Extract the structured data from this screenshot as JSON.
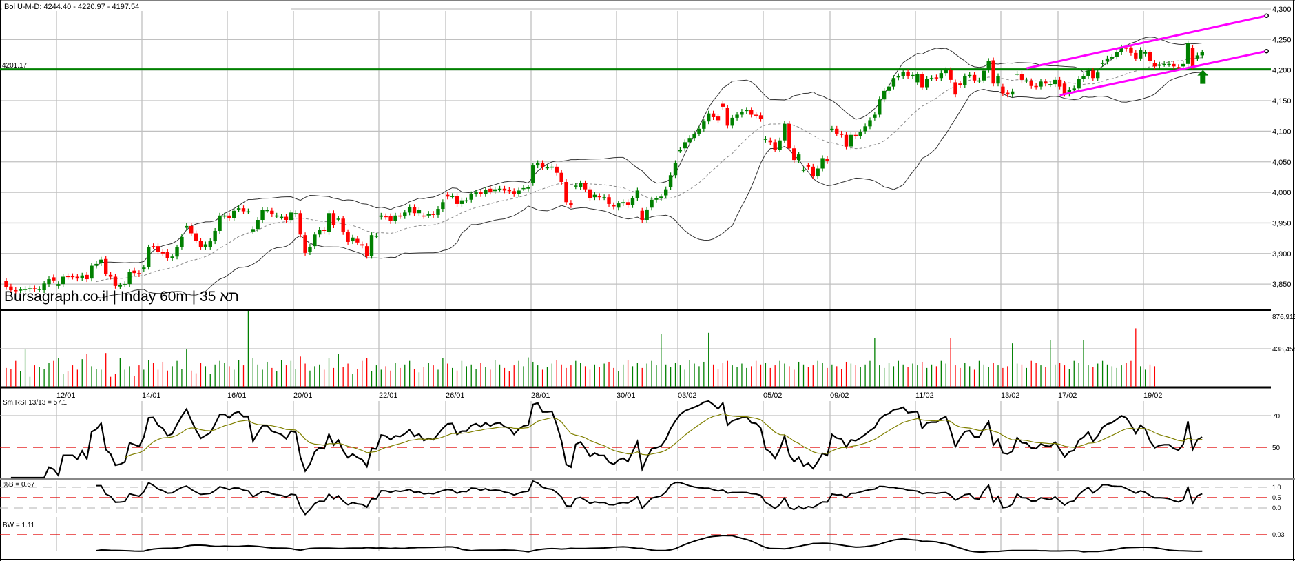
{
  "header": {
    "bollinger_label": "Bol U-M-D: 4244.40 - 4220.97 - 4197.54",
    "level_label": "4201.17",
    "watermark": "Bursagraph.co.il | Inday 60m | 35 תא"
  },
  "colors": {
    "up": "#008000",
    "down": "#ff0000",
    "trendline": "#ff00ff",
    "level": "#008000",
    "band": "#333333",
    "rsi_signal": "#808000"
  },
  "chart_data": [
    {
      "type": "candlestick",
      "title": "",
      "y_ticks": [
        "4,300",
        "4,250",
        "4,200",
        "4,150",
        "4,100",
        "4,050",
        "4,000",
        "3,950",
        "3,900",
        "3,850"
      ],
      "y_tick_values": [
        4300,
        4250,
        4200,
        4150,
        4100,
        4050,
        4000,
        3950,
        3900,
        3850
      ],
      "ylim": [
        3830,
        4315
      ],
      "x_ticks": [
        "12/01",
        "14/01",
        "16/01",
        "20/01",
        "22/01",
        "26/01",
        "28/01",
        "30/01",
        "03/02",
        "05/02",
        "09/02",
        "11/02",
        "13/02",
        "17/02",
        "19/02"
      ],
      "x_tick_bar_index": [
        11,
        29,
        47,
        61,
        79,
        93,
        111,
        129,
        142,
        160,
        174,
        192,
        210,
        222,
        240
      ],
      "horizontal_level": 4201.17,
      "trendlines": [
        {
          "from": [
            215,
            4203
          ],
          "to": [
            266,
            4289
          ]
        },
        {
          "from": [
            222,
            4159
          ],
          "to": [
            266,
            4231
          ]
        }
      ],
      "signal_arrow": {
        "bar_index": 252,
        "direction": "up"
      },
      "overlay": "Bollinger Bands (20)",
      "open_close": [
        [
          3855,
          3845
        ],
        [
          3846,
          3840
        ],
        [
          3840,
          3839
        ],
        [
          3840,
          3841
        ],
        [
          3841,
          3842
        ],
        [
          3842,
          3843
        ],
        [
          3843,
          3842
        ],
        [
          3841,
          3842
        ],
        [
          3840,
          3851
        ],
        [
          3850,
          3858
        ],
        [
          3861,
          3856
        ],
        [
          3847,
          3850
        ],
        [
          3850,
          3862
        ],
        [
          3863,
          3862
        ],
        [
          3863,
          3862
        ],
        [
          3862,
          3859
        ],
        [
          3860,
          3864
        ],
        [
          3865,
          3858
        ],
        [
          3859,
          3880
        ],
        [
          3880,
          3883
        ],
        [
          3884,
          3890
        ],
        [
          3891,
          3867
        ],
        [
          3865,
          3862
        ],
        [
          3862,
          3847
        ],
        [
          3846,
          3848
        ],
        [
          3849,
          3850
        ],
        [
          3850,
          3870
        ],
        [
          3872,
          3868
        ],
        [
          3868,
          3866
        ],
        [
          3875,
          3877
        ],
        [
          3878,
          3910
        ],
        [
          3912,
          3911
        ],
        [
          3912,
          3903
        ],
        [
          3903,
          3900
        ],
        [
          3902,
          3892
        ],
        [
          3892,
          3895
        ],
        [
          3895,
          3910
        ],
        [
          3910,
          3927
        ],
        [
          3942,
          3945
        ],
        [
          3945,
          3933
        ],
        [
          3933,
          3921
        ],
        [
          3921,
          3910
        ],
        [
          3910,
          3915
        ],
        [
          3910,
          3920
        ],
        [
          3920,
          3937
        ],
        [
          3937,
          3962
        ],
        [
          3961,
          3962
        ],
        [
          3962,
          3958
        ],
        [
          3958,
          3970
        ],
        [
          3972,
          3974
        ],
        [
          3974,
          3969
        ],
        [
          3969,
          3969
        ],
        [
          3936,
          3940
        ],
        [
          3940,
          3955
        ],
        [
          3955,
          3971
        ],
        [
          3971,
          3971
        ],
        [
          3970,
          3964
        ],
        [
          3962,
          3962
        ],
        [
          3960,
          3960
        ],
        [
          3960,
          3955
        ],
        [
          3955,
          3967
        ],
        [
          3964,
          3966
        ],
        [
          3966,
          3931
        ],
        [
          3930,
          3901
        ],
        [
          3902,
          3911
        ],
        [
          3912,
          3931
        ],
        [
          3931,
          3939
        ],
        [
          3939,
          3937
        ],
        [
          3935,
          3966
        ],
        [
          3966,
          3946
        ],
        [
          3957,
          3957
        ],
        [
          3957,
          3935
        ],
        [
          3935,
          3919
        ],
        [
          3920,
          3926
        ],
        [
          3924,
          3918
        ],
        [
          3915,
          3913
        ],
        [
          3912,
          3896
        ],
        [
          3896,
          3930
        ],
        [
          3929,
          3929
        ],
        [
          3960,
          3962
        ],
        [
          3961,
          3960
        ],
        [
          3961,
          3953
        ],
        [
          3953,
          3962
        ],
        [
          3962,
          3961
        ],
        [
          3961,
          3967
        ],
        [
          3967,
          3976
        ],
        [
          3976,
          3966
        ],
        [
          3966,
          3971
        ],
        [
          3962,
          3961
        ],
        [
          3962,
          3965
        ],
        [
          3965,
          3963
        ],
        [
          3963,
          3973
        ],
        [
          3973,
          3984
        ],
        [
          3996,
          3993
        ],
        [
          3994,
          3994
        ],
        [
          3994,
          3981
        ],
        [
          3981,
          3987
        ],
        [
          3987,
          3987
        ],
        [
          3988,
          3997
        ],
        [
          3997,
          4000
        ],
        [
          4000,
          3997
        ],
        [
          3997,
          4004
        ],
        [
          4006,
          4001
        ],
        [
          4002,
          4005
        ],
        [
          4006,
          4006
        ],
        [
          4006,
          4003
        ],
        [
          4004,
          4002
        ],
        [
          4002,
          3997
        ],
        [
          3997,
          4003
        ],
        [
          4007,
          4007
        ],
        [
          4006,
          4008
        ],
        [
          4015,
          4044
        ],
        [
          4044,
          4048
        ],
        [
          4048,
          4041
        ],
        [
          4041,
          4041
        ],
        [
          4041,
          4042
        ],
        [
          4042,
          4032
        ],
        [
          4032,
          4017
        ],
        [
          4017,
          3984
        ],
        [
          3983,
          3979
        ],
        [
          4010,
          4011
        ],
        [
          4008,
          4015
        ],
        [
          4015,
          4005
        ],
        [
          4005,
          3991
        ],
        [
          3992,
          3996
        ],
        [
          3994,
          3992
        ],
        [
          3992,
          3992
        ],
        [
          3992,
          3981
        ],
        [
          3979,
          3977
        ],
        [
          3975,
          3982
        ],
        [
          3982,
          3984
        ],
        [
          3984,
          3979
        ],
        [
          3979,
          3990
        ],
        [
          3990,
          4003
        ],
        [
          3970,
          3955
        ],
        [
          3955,
          3972
        ],
        [
          3975,
          3988
        ],
        [
          3988,
          3990
        ],
        [
          3991,
          3993
        ],
        [
          3995,
          4005
        ],
        [
          4008,
          4028
        ],
        [
          4028,
          4048
        ],
        [
          4069,
          4069
        ],
        [
          4072,
          4082
        ],
        [
          4082,
          4089
        ],
        [
          4089,
          4096
        ],
        [
          4096,
          4104
        ],
        [
          4104,
          4116
        ],
        [
          4116,
          4129
        ],
        [
          4129,
          4123
        ],
        [
          4124,
          4118
        ],
        [
          4145,
          4140
        ],
        [
          4138,
          4109
        ],
        [
          4109,
          4122
        ],
        [
          4122,
          4127
        ],
        [
          4127,
          4132
        ],
        [
          4133,
          4135
        ],
        [
          4135,
          4127
        ],
        [
          4127,
          4126
        ],
        [
          4126,
          4120
        ],
        [
          4086,
          4088
        ],
        [
          4085,
          4082
        ],
        [
          4082,
          4070
        ],
        [
          4070,
          4085
        ],
        [
          4085,
          4112
        ],
        [
          4112,
          4072
        ],
        [
          4072,
          4053
        ],
        [
          4053,
          4062
        ],
        [
          4037,
          4037
        ],
        [
          4044,
          4042
        ],
        [
          4042,
          4026
        ],
        [
          4026,
          4039
        ],
        [
          4039,
          4056
        ],
        [
          4055,
          4051
        ],
        [
          4103,
          4104
        ],
        [
          4104,
          4096
        ],
        [
          4096,
          4094
        ],
        [
          4094,
          4075
        ],
        [
          4075,
          4094
        ],
        [
          4094,
          4092
        ],
        [
          4092,
          4099
        ],
        [
          4100,
          4108
        ],
        [
          4108,
          4118
        ],
        [
          4122,
          4127
        ],
        [
          4127,
          4152
        ],
        [
          4152,
          4166
        ],
        [
          4166,
          4173
        ],
        [
          4173,
          4187
        ],
        [
          4188,
          4190
        ],
        [
          4190,
          4197
        ],
        [
          4197,
          4190
        ],
        [
          4190,
          4192
        ],
        [
          4180,
          4193
        ],
        [
          4193,
          4172
        ],
        [
          4172,
          4185
        ],
        [
          4187,
          4187
        ],
        [
          4188,
          4187
        ],
        [
          4187,
          4195
        ],
        [
          4195,
          4200
        ],
        [
          4200,
          4184
        ],
        [
          4180,
          4160
        ],
        [
          4178,
          4176
        ],
        [
          4176,
          4190
        ],
        [
          4192,
          4192
        ],
        [
          4192,
          4183
        ],
        [
          4183,
          4183
        ],
        [
          4183,
          4199
        ],
        [
          4200,
          4215
        ],
        [
          4216,
          4178
        ],
        [
          4178,
          4190
        ],
        [
          4173,
          4162
        ],
        [
          4163,
          4160
        ],
        [
          4160,
          4165
        ],
        [
          4194,
          4194
        ],
        [
          4194,
          4184
        ],
        [
          4183,
          4183
        ],
        [
          4182,
          4174
        ],
        [
          4174,
          4173
        ],
        [
          4173,
          4181
        ],
        [
          4181,
          4178
        ],
        [
          4177,
          4177
        ],
        [
          4177,
          4184
        ],
        [
          4184,
          4173
        ],
        [
          4178,
          4161
        ],
        [
          4161,
          4168
        ],
        [
          4168,
          4170
        ],
        [
          4170,
          4185
        ],
        [
          4185,
          4190
        ],
        [
          4190,
          4199
        ],
        [
          4199,
          4187
        ],
        [
          4187,
          4196
        ],
        [
          4210,
          4212
        ],
        [
          4214,
          4219
        ],
        [
          4219,
          4222
        ],
        [
          4222,
          4229
        ],
        [
          4229,
          4237
        ],
        [
          4237,
          4235
        ],
        [
          4237,
          4228
        ],
        [
          4228,
          4219
        ],
        [
          4219,
          4233
        ],
        [
          4227,
          4229
        ],
        [
          4229,
          4215
        ],
        [
          4212,
          4206
        ],
        [
          4207,
          4209
        ],
        [
          4210,
          4210
        ],
        [
          4210,
          4210
        ],
        [
          4210,
          4206
        ],
        [
          4205,
          4204
        ],
        [
          4206,
          4210
        ],
        [
          4210,
          4244
        ],
        [
          4236,
          4206
        ],
        [
          4219,
          4224
        ],
        [
          4224,
          4229
        ]
      ]
    },
    {
      "type": "bar",
      "title": "",
      "y_ticks": [
        "876,915",
        "438,458"
      ],
      "y_tick_values": [
        876915,
        438458
      ],
      "volume_thousands": [
        220,
        210,
        300,
        180,
        430,
        120,
        250,
        230,
        210,
        280,
        300,
        330,
        150,
        180,
        250,
        200,
        320,
        380,
        240,
        210,
        200,
        390,
        120,
        150,
        330,
        200,
        240,
        130,
        250,
        200,
        310,
        280,
        200,
        290,
        190,
        240,
        300,
        210,
        430,
        190,
        160,
        280,
        240,
        150,
        260,
        300,
        280,
        240,
        200,
        310,
        250,
        876,
        330,
        260,
        200,
        290,
        220,
        180,
        310,
        250,
        300,
        210,
        350,
        270,
        190,
        240,
        260,
        200,
        330,
        220,
        380,
        230,
        270,
        150,
        210,
        300,
        330,
        180,
        250,
        200,
        240,
        190,
        280,
        220,
        260,
        300,
        210,
        170,
        230,
        280,
        250,
        200,
        330,
        270,
        220,
        190,
        300,
        240,
        260,
        210,
        280,
        230,
        200,
        310,
        260,
        220,
        180,
        250,
        300,
        240,
        340,
        290,
        250,
        200,
        230,
        270,
        310,
        260,
        220,
        250,
        300,
        280,
        240,
        200,
        260,
        230,
        270,
        290,
        220,
        180,
        260,
        310,
        240,
        280,
        220,
        270,
        300,
        250,
        610,
        260,
        230,
        280,
        250,
        200,
        310,
        270,
        240,
        290,
        620,
        260,
        210,
        280,
        300,
        250,
        230,
        270,
        220,
        240,
        300,
        260,
        280,
        220,
        250,
        300,
        270,
        240,
        200,
        290,
        260,
        230,
        250,
        300,
        280,
        220,
        260,
        240,
        210,
        290,
        270,
        250,
        230,
        260,
        300,
        560,
        250,
        220,
        280,
        240,
        300,
        260,
        230,
        270,
        250,
        290,
        220,
        260,
        240,
        300,
        270,
        560,
        250,
        220,
        280,
        240,
        200,
        300,
        260,
        230,
        280,
        250,
        220,
        240,
        500,
        270,
        260,
        220,
        300,
        280,
        250,
        230,
        540,
        260,
        280,
        250,
        210,
        300,
        280,
        540,
        250,
        230,
        270,
        300,
        260,
        240,
        220,
        250,
        280,
        300,
        670,
        240,
        200,
        260,
        240
      ]
    },
    {
      "type": "line",
      "title": "Sm.RSI 13/13 = 57.1",
      "y_ticks": [
        "70",
        "50"
      ],
      "y_tick_values": [
        70,
        50
      ],
      "ylim": [
        30,
        80
      ],
      "reference_line": 50
    },
    {
      "type": "line",
      "title": "%B = 0.67",
      "y_ticks": [
        "1.0",
        "0.5",
        "0.0"
      ],
      "y_tick_values": [
        1.0,
        0.5,
        0.0
      ],
      "reference_line": 0.5
    },
    {
      "type": "line",
      "title": "BW = 1.11",
      "y_ticks": [
        "0.03"
      ]
    }
  ]
}
